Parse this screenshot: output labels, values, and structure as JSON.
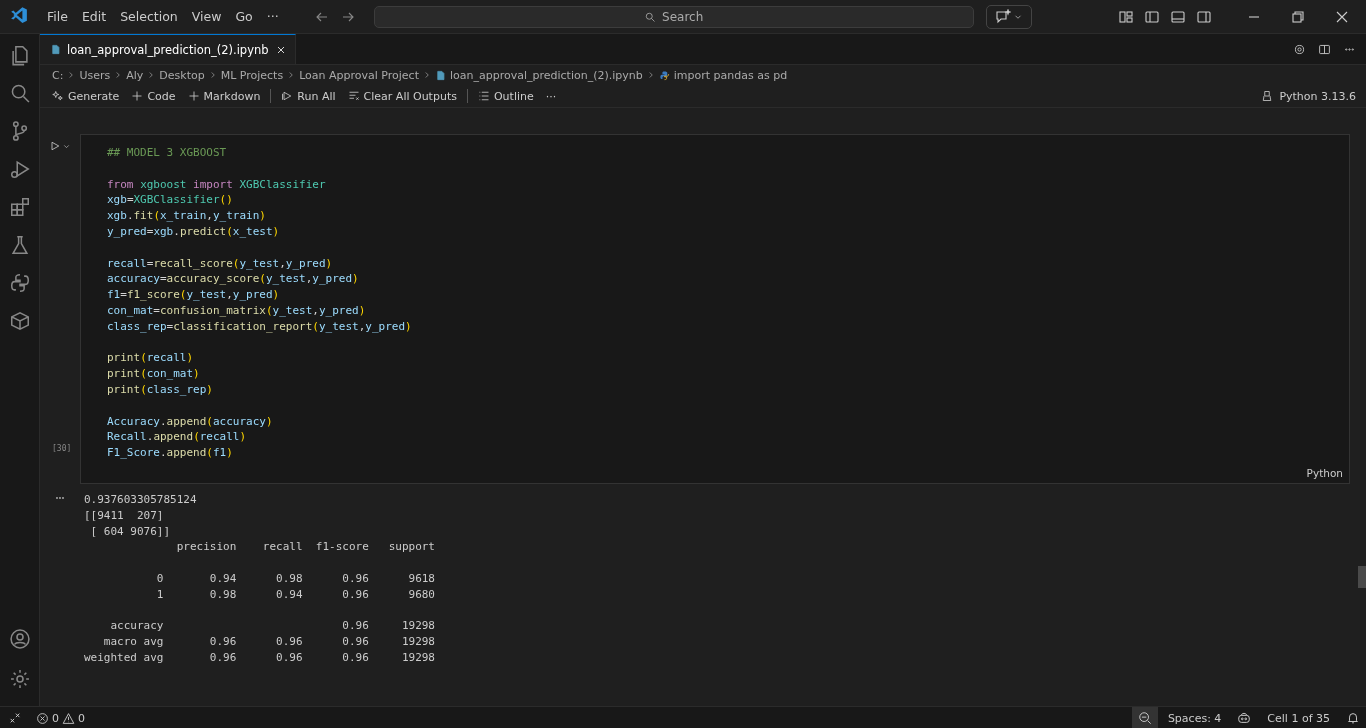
{
  "menu": [
    "File",
    "Edit",
    "Selection",
    "View",
    "Go",
    "···"
  ],
  "search": {
    "placeholder": "Search"
  },
  "tabs": [
    {
      "label": "loan_approval_prediction_(2).ipynb",
      "selected": true
    }
  ],
  "breadcrumb": [
    {
      "label": "C:",
      "kind": "folder"
    },
    {
      "label": "Users",
      "kind": "folder"
    },
    {
      "label": "Aly",
      "kind": "folder"
    },
    {
      "label": "Desktop",
      "kind": "folder"
    },
    {
      "label": "ML Projects",
      "kind": "folder"
    },
    {
      "label": "Loan Approval Project",
      "kind": "folder"
    },
    {
      "label": "loan_approval_prediction_(2).ipynb",
      "kind": "notebook"
    },
    {
      "label": "import pandas as pd",
      "kind": "cell"
    }
  ],
  "toolbar": [
    {
      "label": "Generate",
      "kind": "sparkle"
    },
    {
      "label": "Code",
      "kind": "plus"
    },
    {
      "label": "Markdown",
      "kind": "plus"
    },
    {
      "label": "Run All",
      "kind": "run",
      "divider": true
    },
    {
      "label": "Clear All Outputs",
      "kind": "clear"
    },
    {
      "label": "Outline",
      "kind": "list",
      "divider": true
    },
    {
      "label": "···",
      "kind": "more"
    }
  ],
  "kernel": "Python 3.13.6",
  "cell": {
    "execution_count": "[30]",
    "language": "Python",
    "blocks": [
      [
        [
          {
            "kind": "comment",
            "text": "## MODEL 3 XGBOOST"
          }
        ]
      ],
      [
        [
          {
            "kind": "keyword",
            "text": "from"
          },
          {
            "kind": "type",
            "text": "xgboost",
            "space_before": true
          },
          {
            "kind": "keyword",
            "text": "import",
            "space_before": true
          },
          {
            "kind": "type",
            "text": "XGBClassifier",
            "space_before": true
          }
        ],
        [
          {
            "kind": "var",
            "text": "xgb"
          },
          {
            "kind": "plain",
            "text": "="
          },
          {
            "kind": "type",
            "text": "XGBClassifier"
          },
          {
            "kind": "paren",
            "text": "()"
          }
        ],
        [
          {
            "kind": "var",
            "text": "xgb"
          },
          {
            "kind": "plain",
            "text": "."
          },
          {
            "kind": "func",
            "text": "fit"
          },
          {
            "kind": "paren",
            "text": "("
          },
          {
            "kind": "var",
            "text": "x_train"
          },
          {
            "kind": "plain",
            "text": ","
          },
          {
            "kind": "var",
            "text": "y_train"
          },
          {
            "kind": "paren",
            "text": ")"
          }
        ],
        [
          {
            "kind": "var",
            "text": "y_pred"
          },
          {
            "kind": "plain",
            "text": "="
          },
          {
            "kind": "var",
            "text": "xgb"
          },
          {
            "kind": "plain",
            "text": "."
          },
          {
            "kind": "func",
            "text": "predict"
          },
          {
            "kind": "paren",
            "text": "("
          },
          {
            "kind": "var",
            "text": "x_test"
          },
          {
            "kind": "paren",
            "text": ")"
          }
        ]
      ],
      [
        [
          {
            "kind": "var",
            "text": "recall"
          },
          {
            "kind": "plain",
            "text": "="
          },
          {
            "kind": "func",
            "text": "recall_score"
          },
          {
            "kind": "paren",
            "text": "("
          },
          {
            "kind": "var",
            "text": "y_test"
          },
          {
            "kind": "plain",
            "text": ","
          },
          {
            "kind": "var",
            "text": "y_pred"
          },
          {
            "kind": "paren",
            "text": ")"
          }
        ],
        [
          {
            "kind": "var",
            "text": "accuracy"
          },
          {
            "kind": "plain",
            "text": "="
          },
          {
            "kind": "func",
            "text": "accuracy_score"
          },
          {
            "kind": "paren",
            "text": "("
          },
          {
            "kind": "var",
            "text": "y_test"
          },
          {
            "kind": "plain",
            "text": ","
          },
          {
            "kind": "var",
            "text": "y_pred"
          },
          {
            "kind": "paren",
            "text": ")"
          }
        ],
        [
          {
            "kind": "var",
            "text": "f1"
          },
          {
            "kind": "plain",
            "text": "="
          },
          {
            "kind": "func",
            "text": "f1_score"
          },
          {
            "kind": "paren",
            "text": "("
          },
          {
            "kind": "var",
            "text": "y_test"
          },
          {
            "kind": "plain",
            "text": ","
          },
          {
            "kind": "var",
            "text": "y_pred"
          },
          {
            "kind": "paren",
            "text": ")"
          }
        ],
        [
          {
            "kind": "var",
            "text": "con_mat"
          },
          {
            "kind": "plain",
            "text": "="
          },
          {
            "kind": "func",
            "text": "confusion_matrix"
          },
          {
            "kind": "paren",
            "text": "("
          },
          {
            "kind": "var",
            "text": "y_test"
          },
          {
            "kind": "plain",
            "text": ","
          },
          {
            "kind": "var",
            "text": "y_pred"
          },
          {
            "kind": "paren",
            "text": ")"
          }
        ],
        [
          {
            "kind": "var",
            "text": "class_rep"
          },
          {
            "kind": "plain",
            "text": "="
          },
          {
            "kind": "func",
            "text": "classification_report"
          },
          {
            "kind": "paren",
            "text": "("
          },
          {
            "kind": "var",
            "text": "y_test"
          },
          {
            "kind": "plain",
            "text": ","
          },
          {
            "kind": "var",
            "text": "y_pred"
          },
          {
            "kind": "paren",
            "text": ")"
          }
        ]
      ],
      [
        [
          {
            "kind": "func",
            "text": "print"
          },
          {
            "kind": "paren",
            "text": "("
          },
          {
            "kind": "var",
            "text": "recall"
          },
          {
            "kind": "paren",
            "text": ")"
          }
        ],
        [
          {
            "kind": "func",
            "text": "print"
          },
          {
            "kind": "paren",
            "text": "("
          },
          {
            "kind": "var",
            "text": "con_mat"
          },
          {
            "kind": "paren",
            "text": ")"
          }
        ],
        [
          {
            "kind": "func",
            "text": "print"
          },
          {
            "kind": "paren",
            "text": "("
          },
          {
            "kind": "var",
            "text": "class_rep"
          },
          {
            "kind": "paren",
            "text": ")"
          }
        ]
      ],
      [
        [
          {
            "kind": "var",
            "text": "Accuracy"
          },
          {
            "kind": "plain",
            "text": "."
          },
          {
            "kind": "func",
            "text": "append"
          },
          {
            "kind": "paren",
            "text": "("
          },
          {
            "kind": "var",
            "text": "accuracy"
          },
          {
            "kind": "paren",
            "text": ")"
          }
        ],
        [
          {
            "kind": "var",
            "text": "Recall"
          },
          {
            "kind": "plain",
            "text": "."
          },
          {
            "kind": "func",
            "text": "append"
          },
          {
            "kind": "paren",
            "text": "("
          },
          {
            "kind": "var",
            "text": "recall"
          },
          {
            "kind": "paren",
            "text": ")"
          }
        ],
        [
          {
            "kind": "var",
            "text": "F1_Score"
          },
          {
            "kind": "plain",
            "text": "."
          },
          {
            "kind": "func",
            "text": "append"
          },
          {
            "kind": "paren",
            "text": "("
          },
          {
            "kind": "var",
            "text": "f1"
          },
          {
            "kind": "paren",
            "text": ")"
          }
        ]
      ]
    ],
    "output": "0.937603305785124\n[[9411  207]\n [ 604 9076]]\n              precision    recall  f1-score   support\n\n           0       0.94      0.98      0.96      9618\n           1       0.98      0.94      0.96      9680\n\n    accuracy                           0.96     19298\n   macro avg       0.96      0.96      0.96     19298\nweighted avg       0.96      0.96      0.96     19298"
  },
  "status_bar": {
    "errors": "0",
    "warnings": "0",
    "spaces": "Spaces: 4",
    "cell_position": "Cell 1 of 35"
  }
}
